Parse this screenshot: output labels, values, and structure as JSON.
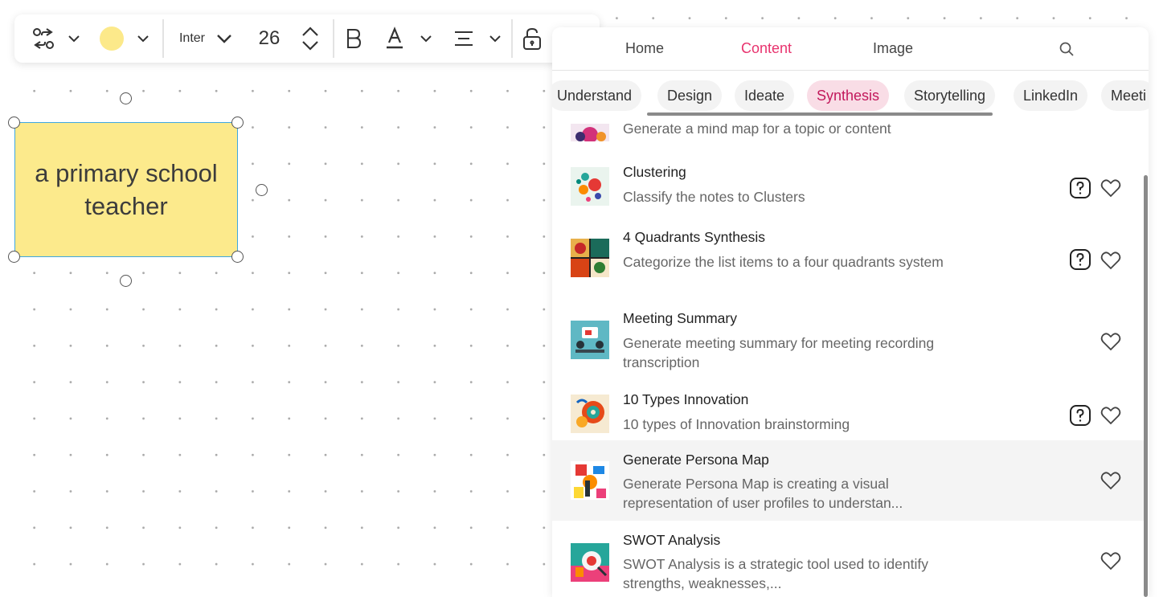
{
  "toolbar": {
    "font_family": "Inter",
    "font_size": "26",
    "fill_color": "#fce98a"
  },
  "sticky_note": {
    "text": "a primary school teacher",
    "color": "#fcea8c"
  },
  "panel": {
    "tabs": [
      {
        "label": "Home"
      },
      {
        "label": "Content"
      },
      {
        "label": "Image"
      }
    ],
    "active_tab": "Content",
    "categories": [
      {
        "label": "Understand"
      },
      {
        "label": "Design"
      },
      {
        "label": "Ideate"
      },
      {
        "label": "Synthesis"
      },
      {
        "label": "Storytelling"
      },
      {
        "label": "LinkedIn"
      },
      {
        "label": "Meeti"
      }
    ],
    "active_category": "Synthesis",
    "items": [
      {
        "title": "",
        "description": "Generate a mind map for a topic or content",
        "has_help": false
      },
      {
        "title": "Clustering",
        "description": "Classify the notes to Clusters",
        "has_help": true
      },
      {
        "title": "4 Quadrants Synthesis",
        "description": "Categorize the list items to a four quadrants system",
        "has_help": true
      },
      {
        "title": "Meeting Summary",
        "description": "Generate meeting summary for meeting recording transcription",
        "has_help": false
      },
      {
        "title": "10 Types Innovation",
        "description": "10 types of Innovation brainstorming",
        "has_help": true
      },
      {
        "title": "Generate Persona Map",
        "description": "Generate Persona Map is creating a visual representation of user profiles to understan...",
        "has_help": false
      },
      {
        "title": "SWOT Analysis",
        "description": "SWOT Analysis is a strategic tool used to identify strengths, weaknesses,...",
        "has_help": false
      }
    ],
    "accent_color": "#e8336e"
  }
}
